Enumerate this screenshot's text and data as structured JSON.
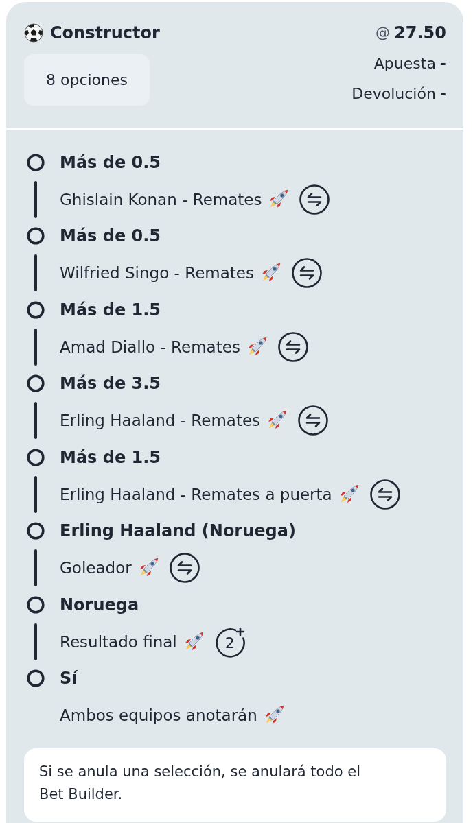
{
  "header": {
    "title": "Constructor",
    "options": "8 opciones",
    "odds_prefix": "@",
    "odds": "27.50",
    "stake": {
      "label": "Apuesta",
      "value": "-"
    },
    "return": {
      "label": "Devolución",
      "value": "-"
    }
  },
  "legs": [
    {
      "selection": "Más de 0.5",
      "market": "Ghislain Konan - Remates",
      "boosted": true,
      "kind": "swap"
    },
    {
      "selection": "Más de 0.5",
      "market": "Wilfried Singo - Remates",
      "boosted": true,
      "kind": "swap"
    },
    {
      "selection": "Más de 1.5",
      "market": "Amad Diallo - Remates",
      "boosted": true,
      "kind": "swap"
    },
    {
      "selection": "Más de 3.5",
      "market": "Erling Haaland - Remates",
      "boosted": true,
      "kind": "swap"
    },
    {
      "selection": "Más de 1.5",
      "market": "Erling Haaland - Remates a puerta",
      "boosted": true,
      "kind": "swap"
    },
    {
      "selection": "Erling Haaland (Noruega)",
      "market": "Goleador",
      "boosted": true,
      "kind": "swap"
    },
    {
      "selection": "Noruega",
      "market": "Resultado final",
      "boosted": true,
      "kind": "extra",
      "badge": "2"
    },
    {
      "selection": "Sí",
      "market": "Ambos equipos anotarán",
      "boosted": true,
      "kind": "plain"
    }
  ],
  "notice": "Si se anula una selección, se anulará todo el Bet Builder."
}
